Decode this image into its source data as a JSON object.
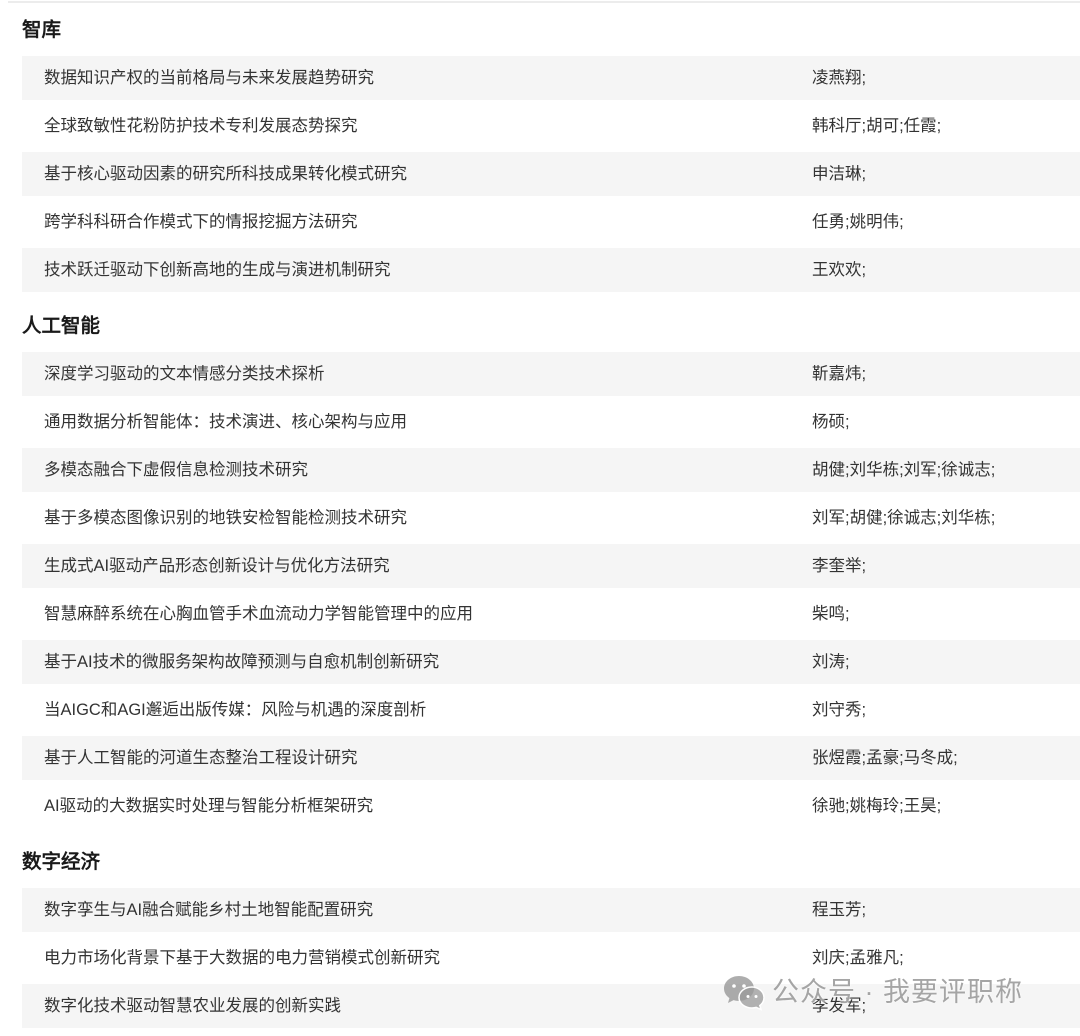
{
  "colors": {
    "row_alt_bg": "#f5f5f5",
    "text": "#333333",
    "heading": "#1a1a1a",
    "watermark": "#8a8a8a"
  },
  "sections": [
    {
      "heading": "智库",
      "rows": [
        {
          "title": "数据知识产权的当前格局与未来发展趋势研究",
          "authors": "凌燕翔;"
        },
        {
          "title": "全球致敏性花粉防护技术专利发展态势探究",
          "authors": "韩科厅;胡可;任霞;"
        },
        {
          "title": "基于核心驱动因素的研究所科技成果转化模式研究",
          "authors": "申洁琳;"
        },
        {
          "title": "跨学科科研合作模式下的情报挖掘方法研究",
          "authors": "任勇;姚明伟;"
        },
        {
          "title": "技术跃迁驱动下创新高地的生成与演进机制研究",
          "authors": "王欢欢;"
        }
      ]
    },
    {
      "heading": "人工智能",
      "rows": [
        {
          "title": "深度学习驱动的文本情感分类技术探析",
          "authors": "靳嘉炜;"
        },
        {
          "title": "通用数据分析智能体：技术演进、核心架构与应用",
          "authors": "杨硕;"
        },
        {
          "title": "多模态融合下虚假信息检测技术研究",
          "authors": "胡健;刘华栋;刘军;徐诚志;"
        },
        {
          "title": "基于多模态图像识别的地铁安检智能检测技术研究",
          "authors": "刘军;胡健;徐诚志;刘华栋;"
        },
        {
          "title": "生成式AI驱动产品形态创新设计与优化方法研究",
          "authors": "李奎举;"
        },
        {
          "title": "智慧麻醉系统在心胸血管手术血流动力学智能管理中的应用",
          "authors": "柴鸣;"
        },
        {
          "title": "基于AI技术的微服务架构故障预测与自愈机制创新研究",
          "authors": "刘涛;"
        },
        {
          "title": "当AIGC和AGI邂逅出版传媒：风险与机遇的深度剖析",
          "authors": "刘守秀;"
        },
        {
          "title": "基于人工智能的河道生态整治工程设计研究",
          "authors": "张煜霞;孟豪;马冬成;"
        },
        {
          "title": "AI驱动的大数据实时处理与智能分析框架研究",
          "authors": "徐驰;姚梅玲;王昊;"
        }
      ]
    },
    {
      "heading": "数字经济",
      "rows": [
        {
          "title": "数字孪生与AI融合赋能乡村土地智能配置研究",
          "authors": "程玉芳;"
        },
        {
          "title": "电力市场化背景下基于大数据的电力营销模式创新研究",
          "authors": "刘庆;孟雅凡;"
        },
        {
          "title": "数字化技术驱动智慧农业发展的创新实践",
          "authors": "李发军;"
        }
      ]
    }
  ],
  "watermark": {
    "icon": "wechat-icon",
    "text": "公众号 · 我要评职称"
  }
}
